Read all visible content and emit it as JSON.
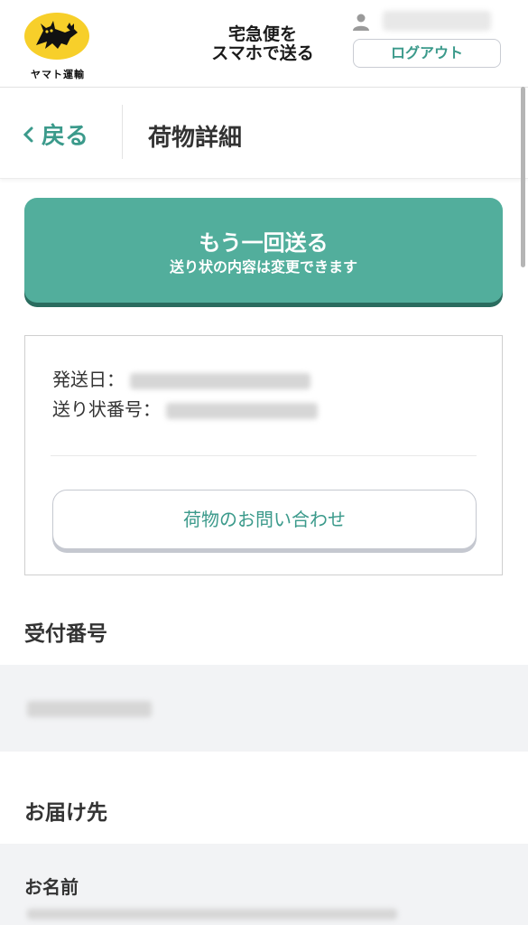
{
  "header": {
    "brand_text": "ヤマト運輸",
    "tagline_line1": "宅急便を",
    "tagline_line2": "スマホで送る",
    "logout_label": "ログアウト"
  },
  "nav": {
    "back_label": "戻る",
    "page_title": "荷物詳細"
  },
  "resend": {
    "main_label": "もう一回送る",
    "sub_label": "送り状の内容は変更できます"
  },
  "shipment": {
    "ship_date_label": "発送日：",
    "tracking_label": "送り状番号：",
    "inquiry_label": "荷物のお問い合わせ"
  },
  "sections": {
    "reception_title": "受付番号",
    "destination_title": "お届け先",
    "name_label": "お名前"
  },
  "colors": {
    "accent": "#52ae9c",
    "accent_text": "#3b9a8b",
    "logo_yellow": "#f7cf2a",
    "band_gray": "#f2f3f5"
  }
}
